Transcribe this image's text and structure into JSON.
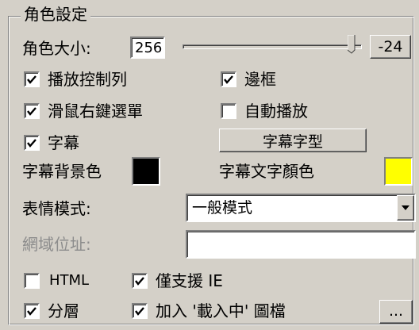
{
  "group": {
    "title": "角色設定"
  },
  "size": {
    "label": "角色大小:",
    "value": "256",
    "slider_level_fraction": 0.97,
    "offset_button": "-24"
  },
  "options": {
    "playback_controls": {
      "label": "播放控制列",
      "checked": true
    },
    "border": {
      "label": "邊框",
      "checked": true
    },
    "right_click_menu": {
      "label": "滑鼠右鍵選單",
      "checked": true
    },
    "autoplay": {
      "label": "自動播放",
      "checked": false
    },
    "subtitles": {
      "label": "字幕",
      "checked": true
    },
    "html": {
      "label": "HTML",
      "checked": false
    },
    "ie_only": {
      "label": "僅支援 IE",
      "checked": true
    },
    "layered": {
      "label": "分層",
      "checked": true
    },
    "loading_image": {
      "label": "加入 '載入中' 圖檔",
      "checked": true
    }
  },
  "subtitle_font_button": "字幕字型",
  "subtitle_bg": {
    "label": "字幕背景色",
    "color": "#000000"
  },
  "subtitle_text": {
    "label": "字幕文字顏色",
    "color": "#ffff00"
  },
  "expression": {
    "label": "表情模式:",
    "selected": "一般模式"
  },
  "url": {
    "label": "網域位址:",
    "value": ""
  },
  "browse_button": "..."
}
